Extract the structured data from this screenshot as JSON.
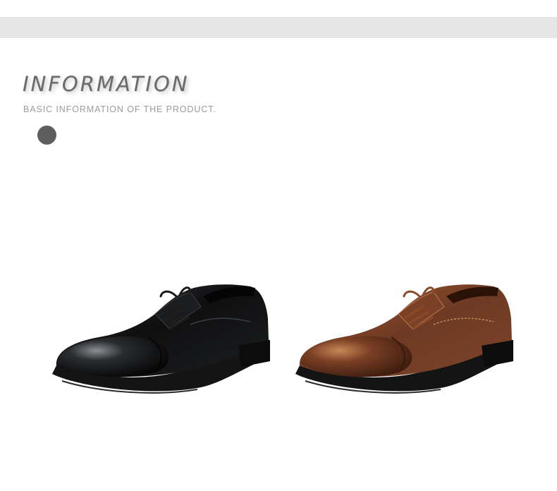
{
  "header": {
    "title": "INFORMATION",
    "subtitle": "BASIC INFORMATION OF THE PRODUCT."
  },
  "products": [
    {
      "name": "black-derby-shoe",
      "color_name": "black",
      "leather": "#111111",
      "highlight": "#6a6f75",
      "laces": "#1a1a1a"
    },
    {
      "name": "brown-derby-shoe",
      "color_name": "brown",
      "leather": "#6e3a23",
      "highlight": "#c07a4c",
      "laces": "#8a4a27"
    }
  ],
  "colors": {
    "band": "#e6e6e6",
    "heading": "#6a6a6a",
    "subheading": "#9b9b9b",
    "dot": "#5e5e5e"
  }
}
